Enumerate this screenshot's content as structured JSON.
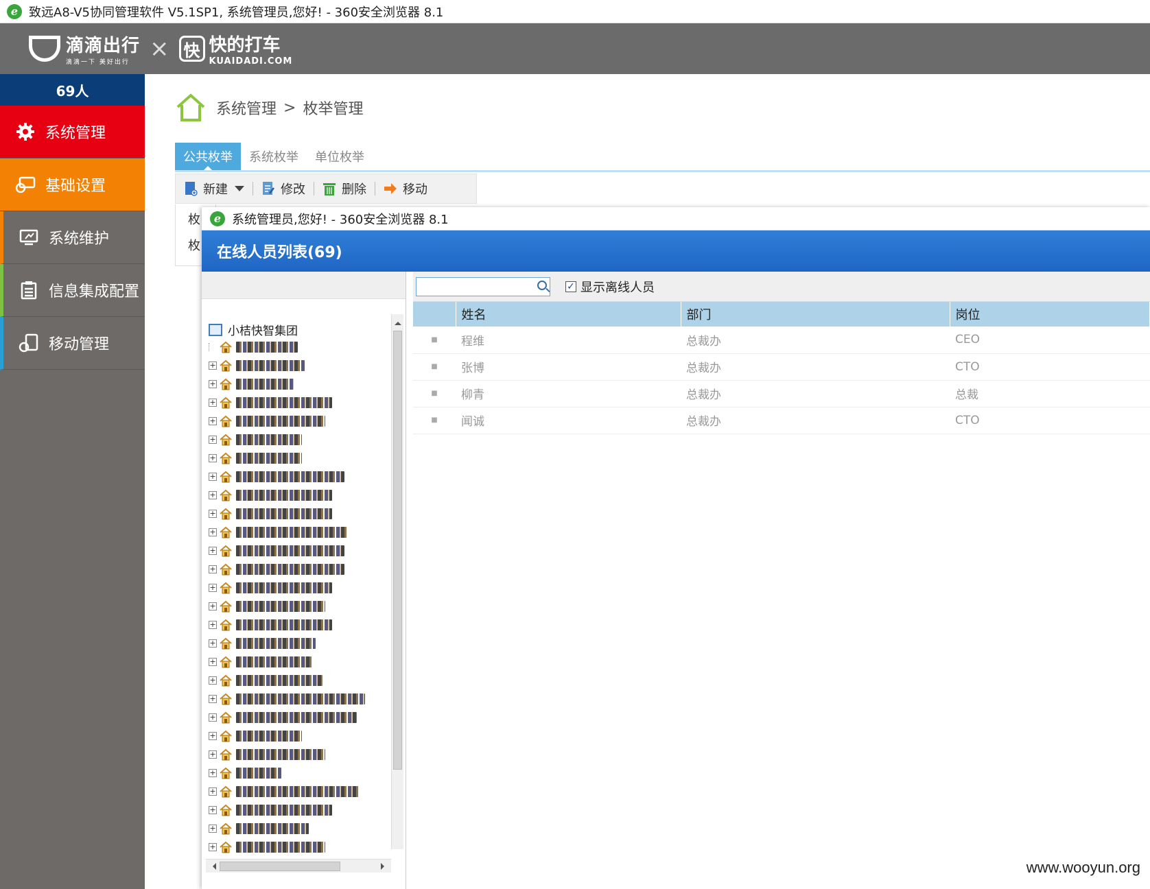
{
  "browser": {
    "title": "致远A8-V5协同管理软件 V5.1SP1, 系统管理员,您好! - 360安全浏览器 8.1"
  },
  "brand": {
    "didi_name": "滴滴出行",
    "didi_slogan": "滴滴一下 美好出行",
    "times": "×",
    "kuaidi_logo_char": "快",
    "kuaidi_name": "快的打车",
    "kuaidi_domain": "KUAIDADI.COM"
  },
  "sidebar": {
    "online_count": "69人",
    "items": [
      {
        "label": "系统管理",
        "icon": "gear-icon"
      },
      {
        "label": "基础设置",
        "icon": "settings-card-icon"
      },
      {
        "label": "系统维护",
        "icon": "monitor-icon"
      },
      {
        "label": "信息集成配置",
        "icon": "clipboard-icon"
      },
      {
        "label": "移动管理",
        "icon": "mobile-icon"
      }
    ]
  },
  "breadcrumb": {
    "root": "系统管理",
    "sep": ">",
    "current": "枚举管理"
  },
  "tabs": [
    {
      "label": "公共枚举",
      "active": true
    },
    {
      "label": "系统枚举",
      "active": false
    },
    {
      "label": "单位枚举",
      "active": false
    }
  ],
  "toolbar": {
    "new_label": "新建",
    "edit_label": "修改",
    "delete_label": "删除",
    "move_label": "移动"
  },
  "under_form": {
    "label1": "枚",
    "label2": "枚"
  },
  "popup": {
    "window_title": "系统管理员,您好! - 360安全浏览器 8.1",
    "header": "在线人员列表(69)",
    "search_placeholder": "",
    "show_offline_label": "显示离线人员",
    "show_offline_checked": true,
    "tree_root": "小桔快智集团",
    "tree_node_count": 28,
    "columns": [
      "姓名",
      "部门",
      "岗位"
    ],
    "rows": [
      {
        "name": "程维",
        "dept": "总裁办",
        "post": "CEO"
      },
      {
        "name": "张博",
        "dept": "总裁办",
        "post": "CTO"
      },
      {
        "name": "柳青",
        "dept": "总裁办",
        "post": "总裁"
      },
      {
        "name": "闻诚",
        "dept": "总裁办",
        "post": "CTO"
      }
    ]
  },
  "watermark": "www.wooyun.org",
  "colors": {
    "nav_active": "#e60012",
    "nav_orange": "#f38204",
    "online_bar": "#0b3d79",
    "popup_header": "#2f7fd8",
    "grid_header": "#aed3e8"
  }
}
